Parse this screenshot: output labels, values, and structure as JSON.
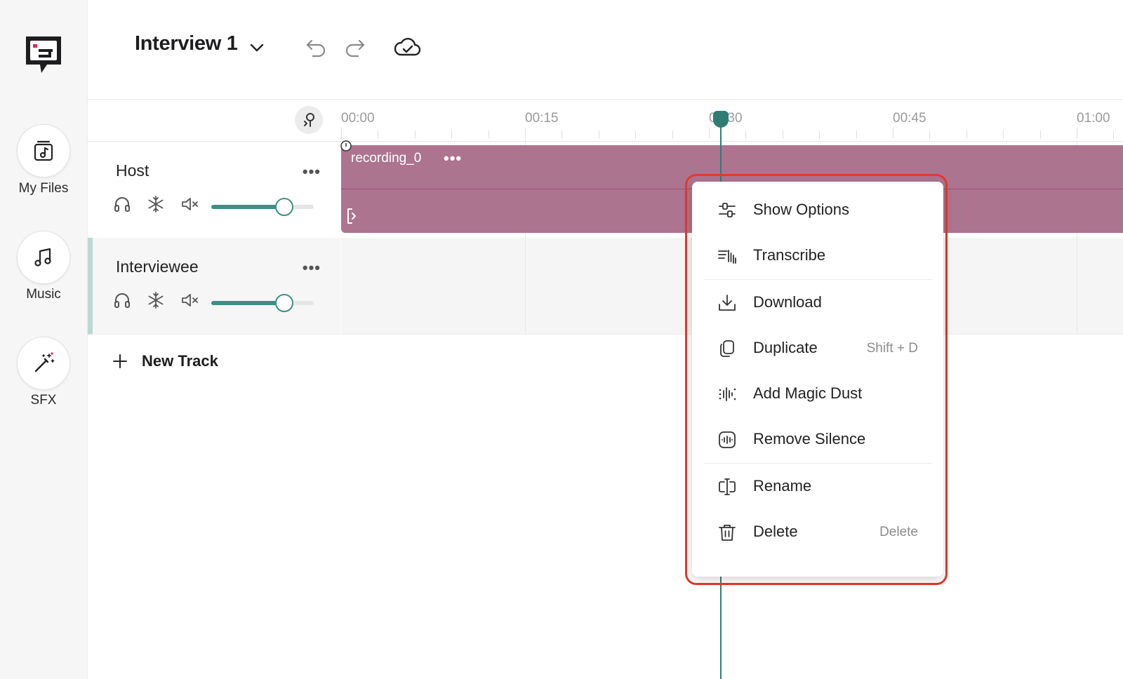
{
  "app": {
    "project_title": "Interview 1"
  },
  "rail": {
    "items": [
      {
        "label": "My Files",
        "icon": "music-file-icon"
      },
      {
        "label": "Music",
        "icon": "music-note-icon"
      },
      {
        "label": "SFX",
        "icon": "magic-wand-icon"
      }
    ]
  },
  "timeline": {
    "ticks": [
      "00:00",
      "00:15",
      "00:30",
      "00:45",
      "01:00"
    ],
    "playhead_seconds": 31
  },
  "tracks": [
    {
      "name": "Host",
      "volume": 0.7,
      "clip": {
        "name": "recording_0"
      }
    },
    {
      "name": "Interviewee",
      "volume": 0.7
    }
  ],
  "new_track_label": "New Track",
  "context_menu": {
    "items": [
      {
        "label": "Show Options",
        "icon": "sliders-icon",
        "shortcut": ""
      },
      {
        "label": "Transcribe",
        "icon": "transcribe-icon",
        "shortcut": ""
      },
      {
        "label": "Download",
        "icon": "download-icon",
        "shortcut": ""
      },
      {
        "label": "Duplicate",
        "icon": "duplicate-icon",
        "shortcut": "Shift + D"
      },
      {
        "label": "Add Magic Dust",
        "icon": "magic-dust-icon",
        "shortcut": ""
      },
      {
        "label": "Remove Silence",
        "icon": "remove-silence-icon",
        "shortcut": ""
      },
      {
        "label": "Rename",
        "icon": "rename-icon",
        "shortcut": ""
      },
      {
        "label": "Delete",
        "icon": "trash-icon",
        "shortcut": "Delete"
      }
    ]
  },
  "colors": {
    "accent": "#3f8f84",
    "playhead": "#2f7d74",
    "clip": "#ad7490",
    "highlight": "#e23a2a"
  }
}
